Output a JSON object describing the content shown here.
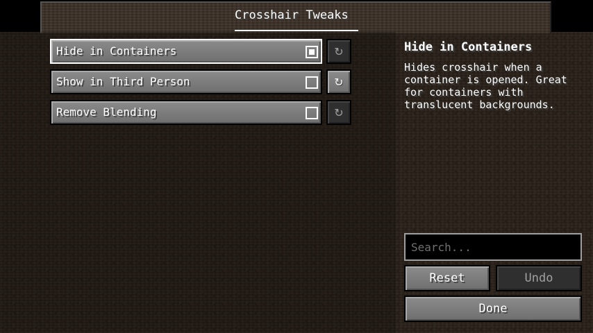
{
  "screen": {
    "title": "Crosshair Tweaks"
  },
  "options": [
    {
      "label": "Hide in Containers",
      "checked": true,
      "selected": true,
      "reset_icon": "reset-arrow-icon",
      "reset_glyph": "↻"
    },
    {
      "label": "Show in Third Person",
      "checked": false,
      "selected": false,
      "reset_icon": "reset-arrow-icon",
      "reset_glyph": "↻"
    },
    {
      "label": "Remove Blending",
      "checked": false,
      "selected": false,
      "reset_icon": "reset-arrow-icon",
      "reset_glyph": "↻"
    }
  ],
  "description": {
    "title": "Hide in Containers",
    "text": "Hides crosshair when a container is opened. Great for containers with translucent backgrounds."
  },
  "search": {
    "placeholder": "Search...",
    "value": ""
  },
  "buttons": {
    "reset_label": "Reset",
    "undo_label": "Undo",
    "done_label": "Done"
  },
  "colors": {
    "text": "#ffffff",
    "disabled_text": "#a0a0a0",
    "button_gray": "#7a7a7a",
    "background_dirt": "#2b221a"
  }
}
